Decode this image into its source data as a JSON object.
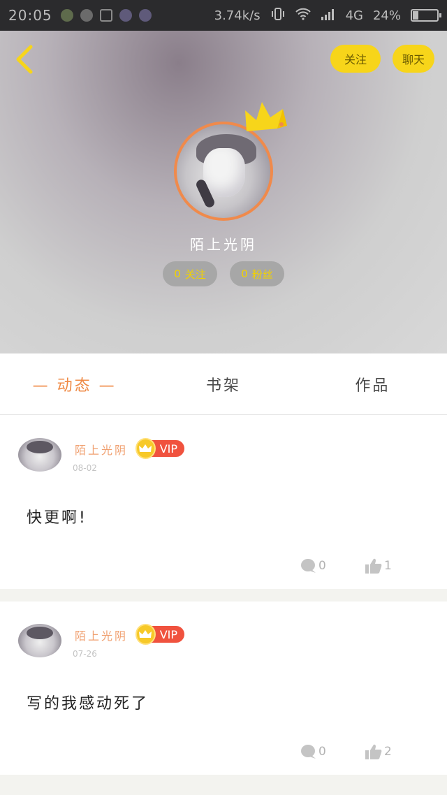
{
  "status_bar": {
    "time": "20:05",
    "speed": "3.74k/s",
    "network": "4G",
    "battery": "24%",
    "battery_level": 0.24
  },
  "header": {
    "follow_button": "关注",
    "chat_button": "聊天",
    "username": "陌上光阴",
    "following_count": "0",
    "following_label": "关注",
    "fans_count": "0",
    "fans_label": "粉丝",
    "accent_color": "#f7d51a",
    "avatar_ring_color": "#f08a4b"
  },
  "tabs": [
    {
      "label": "— 动态 —",
      "active": true
    },
    {
      "label": "书架",
      "active": false
    },
    {
      "label": "作品",
      "active": false
    }
  ],
  "posts": [
    {
      "author": "陌上光阴",
      "vip_label": "VIP",
      "date": "08-02",
      "content": "快更啊!",
      "comments": "0",
      "likes": "1"
    },
    {
      "author": "陌上光阴",
      "vip_label": "VIP",
      "date": "07-26",
      "content": "写的我感动死了",
      "comments": "0",
      "likes": "2"
    }
  ]
}
